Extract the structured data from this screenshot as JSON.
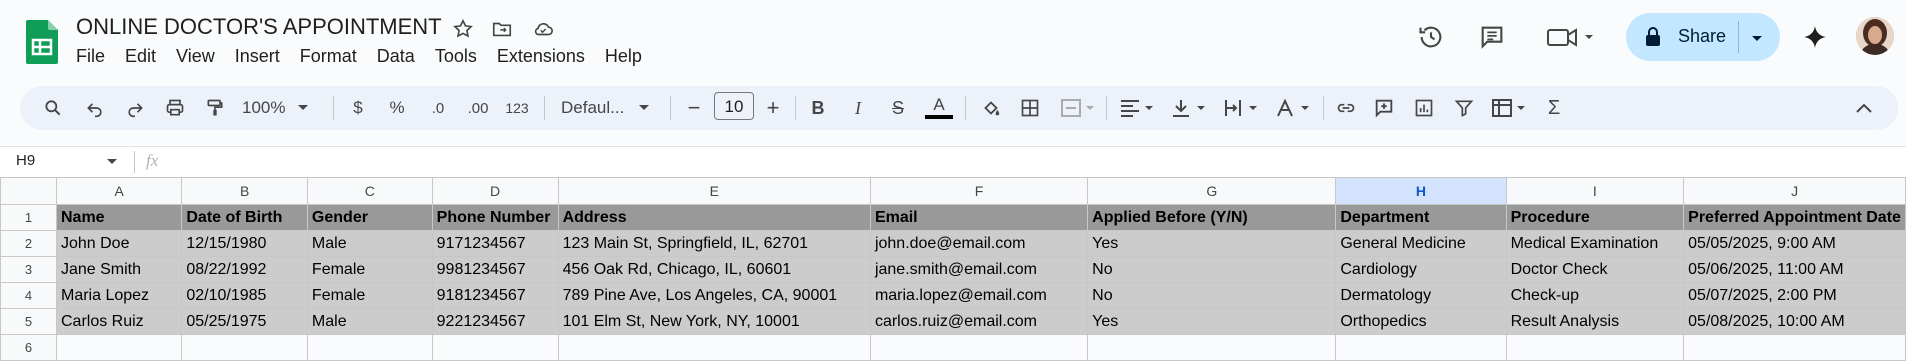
{
  "doc": {
    "title": "ONLINE DOCTOR'S APPOINTMENT"
  },
  "menu": [
    "File",
    "Edit",
    "View",
    "Insert",
    "Format",
    "Data",
    "Tools",
    "Extensions",
    "Help"
  ],
  "header_right": {
    "share_label": "Share"
  },
  "toolbar": {
    "zoom": "100%",
    "currency": "$",
    "percent": "%",
    "dec_decrease": ".0",
    "dec_increase": ".00",
    "number_format": "123",
    "font": "Defaul...",
    "font_size": "10"
  },
  "formula_bar": {
    "cell_ref": "H9",
    "fx": "fx",
    "value": ""
  },
  "columns": [
    "A",
    "B",
    "C",
    "D",
    "E",
    "F",
    "G",
    "H",
    "I",
    "J"
  ],
  "selected_column": "H",
  "rows": [
    [
      "Name",
      "Date of Birth",
      "Gender",
      "Phone Number",
      "Address",
      "Email",
      "Applied Before (Y/N)",
      "Department",
      "Procedure",
      "Preferred Appointment Date"
    ],
    [
      "John Doe",
      "12/15/1980",
      "Male",
      "9171234567",
      "123 Main St, Springfield, IL, 62701",
      "john.doe@email.com",
      "Yes",
      "General Medicine",
      "Medical Examination",
      "05/05/2025, 9:00 AM"
    ],
    [
      "Jane Smith",
      "08/22/1992",
      "Female",
      "9981234567",
      "456 Oak Rd, Chicago, IL, 60601",
      "jane.smith@email.com",
      "No",
      "Cardiology",
      "Doctor Check",
      "05/06/2025, 11:00 AM"
    ],
    [
      "Maria Lopez",
      "02/10/1985",
      "Female",
      "9181234567",
      "789 Pine Ave, Los Angeles, CA, 90001",
      "maria.lopez@email.com",
      "No",
      "Dermatology",
      "Check-up",
      "05/07/2025, 2:00 PM"
    ],
    [
      "Carlos Ruiz",
      "05/25/1975",
      "Male",
      "9221234567",
      "101 Elm St, New York, NY, 10001",
      "carlos.ruiz@email.com",
      "Yes",
      "Orthopedics",
      "Result Analysis",
      "05/08/2025, 10:00 AM"
    ]
  ],
  "row_numbers": [
    "1",
    "2",
    "3",
    "4",
    "5",
    "6"
  ]
}
